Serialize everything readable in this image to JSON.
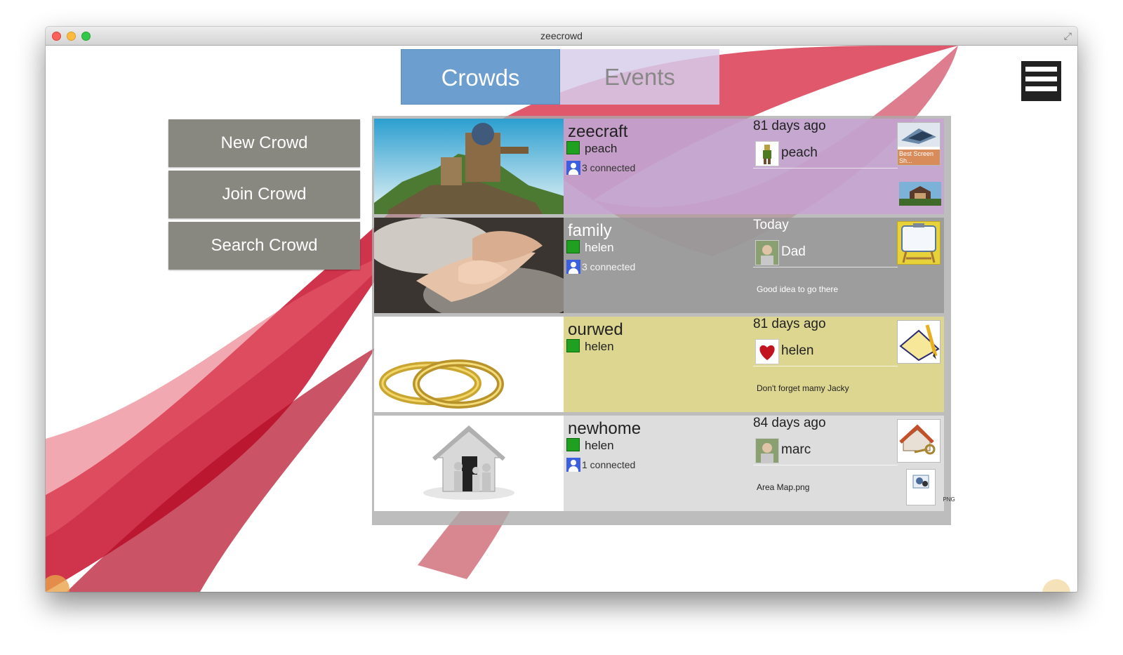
{
  "window": {
    "title": "zeecrowd"
  },
  "tabs": [
    {
      "label": "Crowds",
      "active": true
    },
    {
      "label": "Events",
      "active": false
    }
  ],
  "left_buttons": [
    {
      "label": "New Crowd"
    },
    {
      "label": "Join Crowd"
    },
    {
      "label": "Search Crowd"
    }
  ],
  "crowds": [
    {
      "name": "zeecraft",
      "owner": "peach",
      "connected": "3 connected",
      "when": "81 days ago",
      "poster": "peach",
      "message": "",
      "thumb_caption": "Best Screen Sh...",
      "bg": "rgba(200,160,215,0.75)"
    },
    {
      "name": "family",
      "owner": "helen",
      "connected": "3 connected",
      "when": "Today",
      "poster": "Dad",
      "message": "Good idea to go there",
      "thumb_caption": "",
      "bg": "rgba(150,150,150,0.82)"
    },
    {
      "name": "ourwed",
      "owner": "helen",
      "connected": "",
      "when": "81 days ago",
      "poster": "helen",
      "message": "Don't forget mamy Jacky",
      "thumb_caption": "",
      "bg": "#ddd690"
    },
    {
      "name": "newhome",
      "owner": "helen",
      "connected": "1 connected",
      "when": "84 days ago",
      "poster": "marc",
      "message": "Area Map.png",
      "thumb_caption": "",
      "bg": "#dddddd",
      "file_label": "PNG"
    }
  ],
  "colors": {
    "tab_active": "#6c9fd0",
    "button": "#898880",
    "online": "#20a020"
  }
}
